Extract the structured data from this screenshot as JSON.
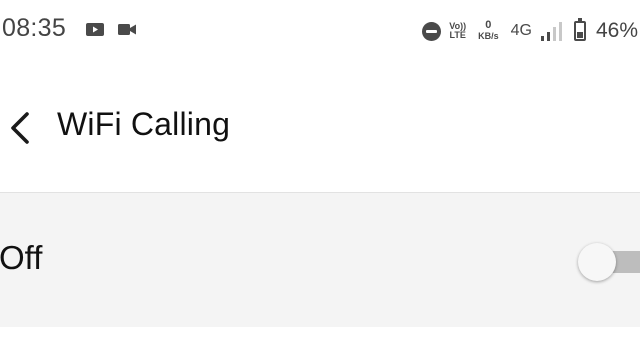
{
  "status_bar": {
    "time": "08:35",
    "notification_icons": [
      "video-recorder-icon",
      "video-camera-icon"
    ],
    "volte_top": "Vo))",
    "volte_bottom": "LTE",
    "speed_value": "0",
    "speed_unit": "KB/s",
    "network_type": "4G",
    "signal_bars_filled": 2,
    "signal_bars_total": 4,
    "battery_level": 0.46,
    "battery_percent": "46%",
    "icons": [
      "do-not-disturb-icon",
      "volte-icon",
      "network-speed-icon",
      "signal-icon",
      "battery-icon"
    ]
  },
  "toolbar": {
    "back_icon": "back-arrow-icon",
    "title": "WiFi Calling"
  },
  "settings": {
    "wifi_calling_label": "Off",
    "wifi_calling_enabled": false
  },
  "colors": {
    "background": "#ffffff",
    "row_background": "#f4f4f4",
    "text_primary": "#111111",
    "status_icons": "#4a4a4a",
    "toggle_track_off": "#bdbdbd",
    "toggle_thumb": "#f7f7f7"
  }
}
